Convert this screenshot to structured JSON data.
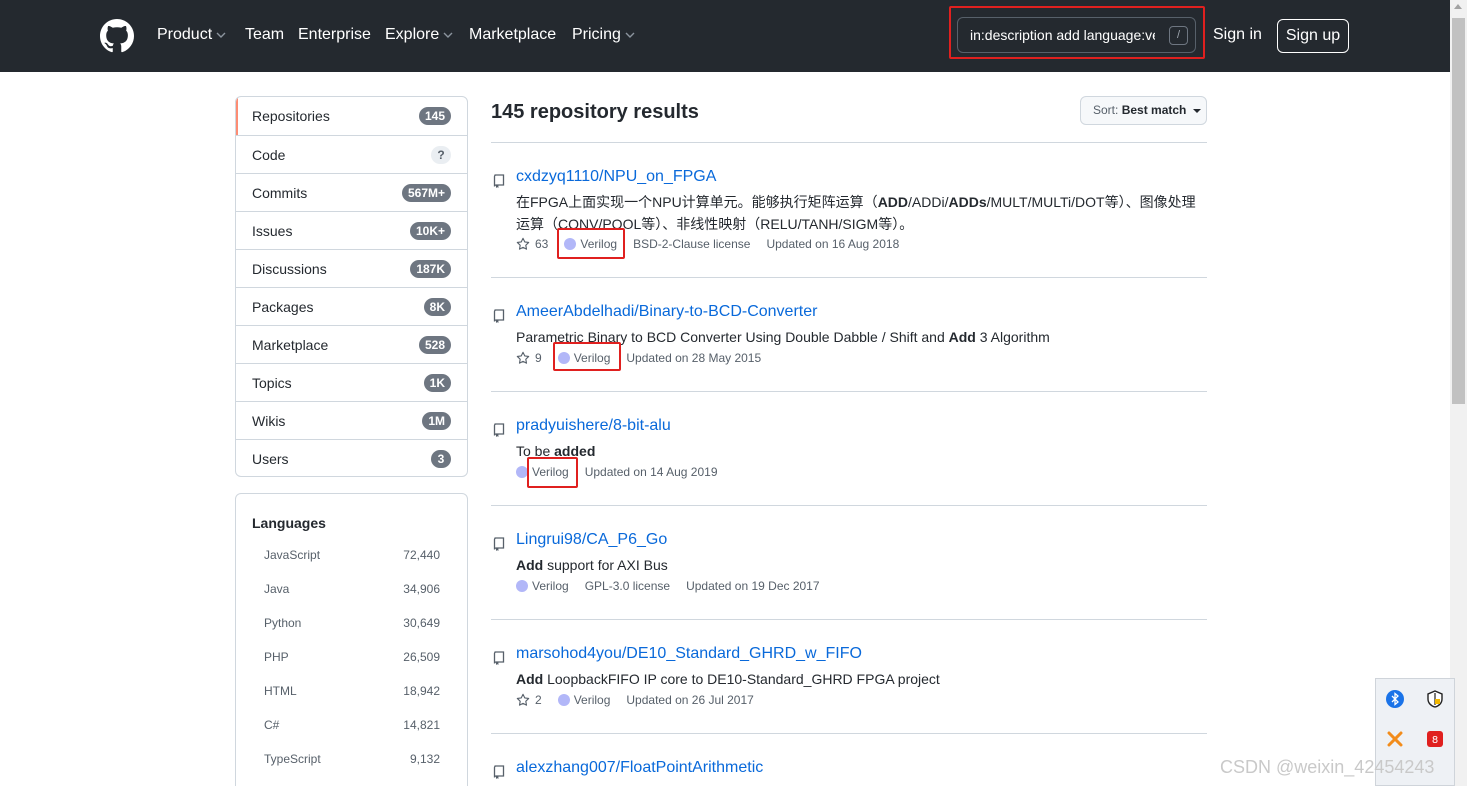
{
  "header": {
    "nav": [
      {
        "label": "Product",
        "dropdown": true
      },
      {
        "label": "Team",
        "dropdown": false
      },
      {
        "label": "Enterprise",
        "dropdown": false
      },
      {
        "label": "Explore",
        "dropdown": true
      },
      {
        "label": "Marketplace",
        "dropdown": false
      },
      {
        "label": "Pricing",
        "dropdown": true
      }
    ],
    "search_value": "in:description add language:ve",
    "search_shortcut": "/",
    "signin_label": "Sign in",
    "signup_label": "Sign up"
  },
  "sidebar": {
    "items": [
      {
        "label": "Repositories",
        "count": "145",
        "selected": true
      },
      {
        "label": "Code",
        "count": "?"
      },
      {
        "label": "Commits",
        "count": "567M+"
      },
      {
        "label": "Issues",
        "count": "10K+"
      },
      {
        "label": "Discussions",
        "count": "187K"
      },
      {
        "label": "Packages",
        "count": "8K"
      },
      {
        "label": "Marketplace",
        "count": "528"
      },
      {
        "label": "Topics",
        "count": "1K"
      },
      {
        "label": "Wikis",
        "count": "1M"
      },
      {
        "label": "Users",
        "count": "3"
      }
    ],
    "languages_title": "Languages",
    "languages": [
      {
        "name": "JavaScript",
        "count": "72,440"
      },
      {
        "name": "Java",
        "count": "34,906"
      },
      {
        "name": "Python",
        "count": "30,649"
      },
      {
        "name": "PHP",
        "count": "26,509"
      },
      {
        "name": "HTML",
        "count": "18,942"
      },
      {
        "name": "C#",
        "count": "14,821"
      },
      {
        "name": "TypeScript",
        "count": "9,132"
      }
    ]
  },
  "results": {
    "title": "145 repository results",
    "sort_prefix": "Sort:",
    "sort_value": "Best match",
    "repos": [
      {
        "name": "cxdzyq1110/NPU_on_FPGA",
        "desc_parts": [
          {
            "t": "在FPGA上面实现一个NPU计算单元。能够执行矩阵运算（"
          },
          {
            "t": "ADD",
            "b": true
          },
          {
            "t": "/ADDi/"
          },
          {
            "t": "ADDs",
            "b": true
          },
          {
            "t": "/MULT/MULTi/DOT等）、图像处理运算（CONV/POOL等）、非线性映射（RELU/TANH/SIGM等）。"
          }
        ],
        "stars": "63",
        "language": "Verilog",
        "license": "BSD-2-Clause license",
        "updated": "Updated on 16 Aug 2018"
      },
      {
        "name": "AmeerAbdelhadi/Binary-to-BCD-Converter",
        "desc_parts": [
          {
            "t": "Parametric Binary to BCD Converter Using Double Dabble / Shift and "
          },
          {
            "t": "Add",
            "b": true
          },
          {
            "t": " 3 Algorithm"
          }
        ],
        "stars": "9",
        "language": "Verilog",
        "license": "",
        "updated": "Updated on 28 May 2015"
      },
      {
        "name": "pradyuishere/8-bit-alu",
        "desc_parts": [
          {
            "t": "To be "
          },
          {
            "t": "added",
            "b": true
          }
        ],
        "stars": "",
        "language": "Verilog",
        "license": "",
        "updated": "Updated on 14 Aug 2019"
      },
      {
        "name": "Lingrui98/CA_P6_Go",
        "desc_parts": [
          {
            "t": "Add",
            "b": true
          },
          {
            "t": " support for AXI Bus"
          }
        ],
        "stars": "",
        "language": "Verilog",
        "license": "GPL-3.0 license",
        "updated": "Updated on 19 Dec 2017"
      },
      {
        "name": "marsohod4you/DE10_Standard_GHRD_w_FIFO",
        "desc_parts": [
          {
            "t": "Add",
            "b": true
          },
          {
            "t": " LoopbackFIFO IP core to DE10-Standard_GHRD FPGA project"
          }
        ],
        "stars": "2",
        "language": "Verilog",
        "license": "",
        "updated": "Updated on 26 Jul 2017"
      },
      {
        "name": "alexzhang007/FloatPointArithmetic",
        "desc_parts": [],
        "stars": "",
        "language": "",
        "license": "",
        "updated": ""
      }
    ]
  },
  "tray_icons": [
    "bluetooth-icon",
    "security-shield-icon",
    "x-app-icon",
    "red-app-icon"
  ],
  "watermark": "CSDN @weixin_42454243",
  "colors": {
    "header_bg": "#24292f",
    "link": "#0969da",
    "verilog_dot": "#b2b7f8",
    "highlight_box": "#e0201f",
    "selected_tab_accent": "#fd8c73"
  }
}
